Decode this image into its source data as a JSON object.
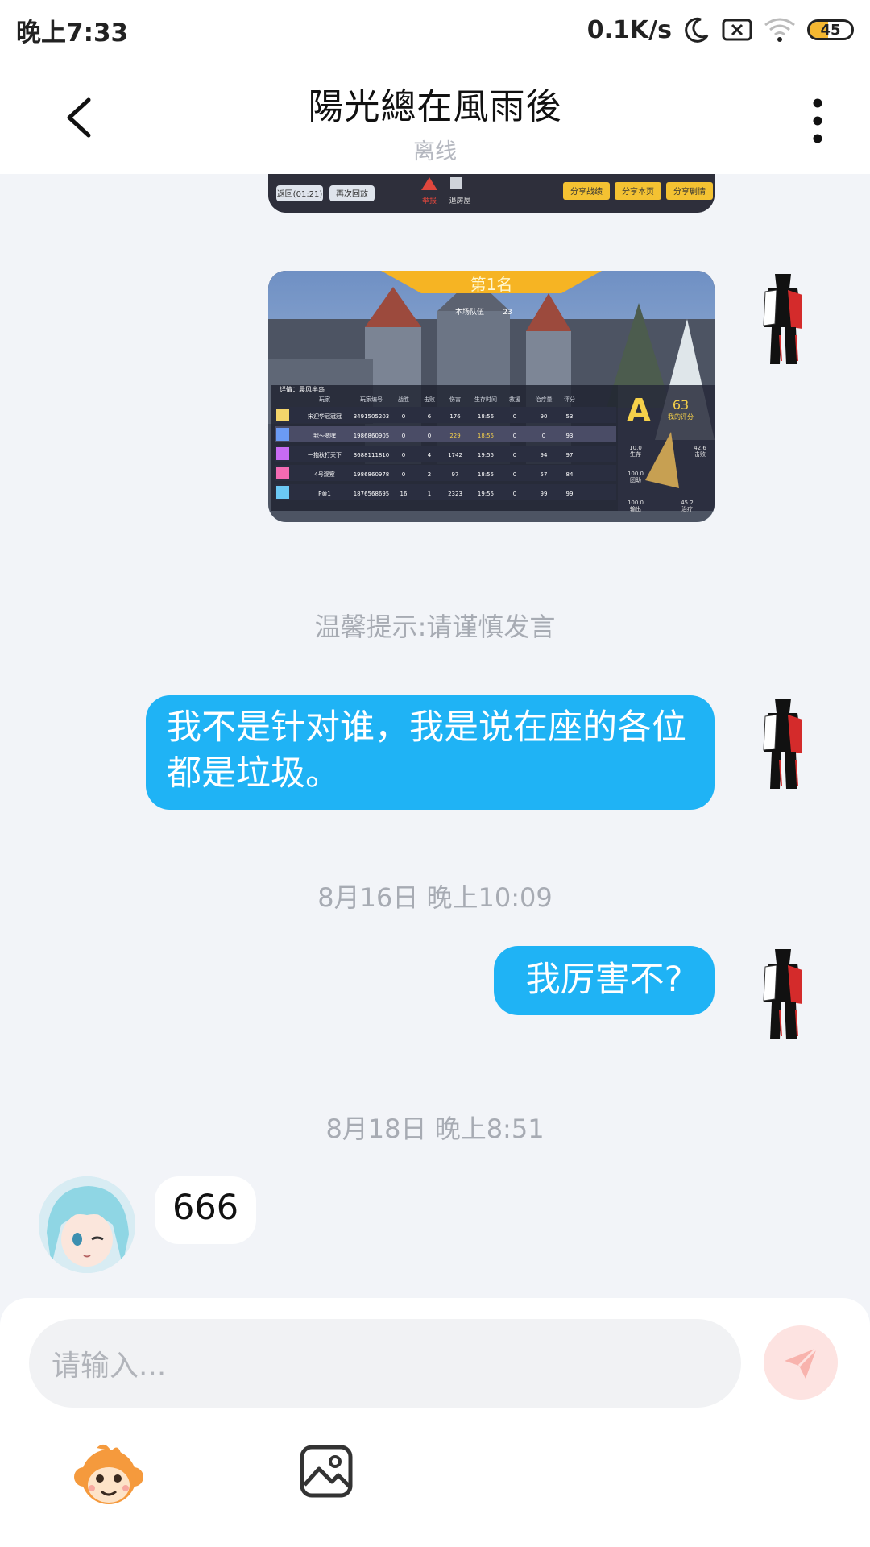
{
  "status_bar": {
    "time": "晚上7:33",
    "net_speed": "0.1K/s",
    "battery_level": "45"
  },
  "header": {
    "title": "陽光總在風雨後",
    "status": "离线"
  },
  "screenshot_top": {
    "buttons": [
      "返回(01:21)",
      "再次回放",
      "分享战绩",
      "分享本页",
      "分享剧情"
    ],
    "center_labels": [
      "举报",
      "退房屋"
    ]
  },
  "screenshot_main": {
    "banner": "第1名",
    "sub_label": "本场队伍",
    "sub_value": "23",
    "team": "详情：晨风半岛",
    "columns": [
      "玩家",
      "玩家编号",
      "战胜",
      "击败",
      "伤害",
      "生存时间",
      "救援",
      "治疗量",
      "评分"
    ],
    "rows": [
      [
        "宋迎华冠冠冠",
        "3491505203",
        "0",
        "6",
        "176",
        "18:56",
        "0",
        "90",
        "53"
      ],
      [
        "我～嗯嘿",
        "1986860905",
        "0",
        "0",
        "229",
        "18:55",
        "0",
        "0",
        "93"
      ],
      [
        "一抱秋打天下",
        "3688111810",
        "0",
        "4",
        "1742",
        "19:55",
        "0",
        "94",
        "97"
      ],
      [
        "4号观察",
        "1986860978",
        "0",
        "2",
        "97",
        "18:55",
        "0",
        "57",
        "84"
      ],
      [
        "P黄1",
        "1876568695",
        "16",
        "1",
        "2323",
        "19:55",
        "0",
        "99",
        "99"
      ]
    ],
    "grade": "A",
    "grade_score": "63",
    "grade_caption": "我的评分",
    "stats": [
      {
        "label": "生存",
        "value": "10.0"
      },
      {
        "label": "团助",
        "value": "100.0"
      },
      {
        "label": "击败",
        "value": "42.6"
      },
      {
        "label": "输出",
        "value": "100.0"
      },
      {
        "label": "治疗",
        "value": "45.2"
      }
    ]
  },
  "system_tip": "温馨提示:请谨慎发言",
  "messages": [
    {
      "direction": "out",
      "text": "我不是针对谁，我是说在座的各位都是垃圾。"
    },
    {
      "timestamp": "8月16日 晚上10:09"
    },
    {
      "direction": "out",
      "text": "我厉害不?"
    },
    {
      "timestamp": "8月18日 晚上8:51"
    },
    {
      "direction": "in",
      "text": "666"
    }
  ],
  "composer": {
    "placeholder": "请输入..."
  },
  "colors": {
    "outgoing_bubble": "#1fb3f5",
    "background": "#f2f4f8",
    "send_button": "#fde3e1",
    "banner_gold": "#f6b423"
  }
}
